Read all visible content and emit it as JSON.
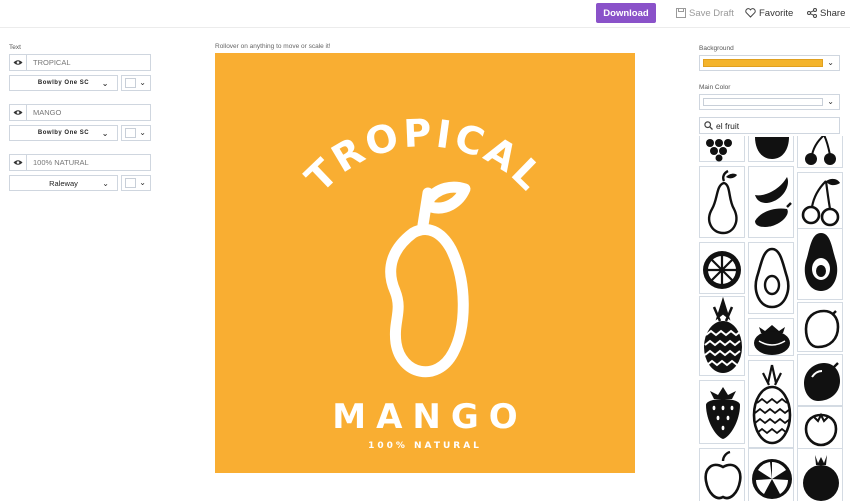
{
  "toolbar": {
    "download_label": "Download",
    "save_draft_label": "Save Draft",
    "favorite_label": "Favorite",
    "share_label": "Share"
  },
  "left_panel": {
    "section_label": "Text",
    "layers": [
      {
        "text": "TROPICAL",
        "font": "Bowlby One SC",
        "color": "#ffffff"
      },
      {
        "text": "MANGO",
        "font": "Bowlby One SC",
        "color": "#ffffff"
      },
      {
        "text": "100% NATURAL",
        "font": "Raleway",
        "color": "#ffffff"
      }
    ]
  },
  "canvas": {
    "hint": "Rollover on anything to move or scale it!",
    "background": "#f9ae32",
    "line1": "TROPICAL",
    "line2": "MANGO",
    "line3": "100% NATURAL"
  },
  "right_panel": {
    "background_label": "Background",
    "background_color": "#f4b42c",
    "main_color_label": "Main Color",
    "main_color": "#ffffff",
    "search_value": "el fruit",
    "icons": [
      "grapes-icon",
      "apple-icon",
      "cherries-icon",
      "pear-icon",
      "bananas-icon",
      "cherries-outline-icon",
      "citrus-slice-icon",
      "avocado-outline-icon",
      "avocado-icon",
      "pineapple-icon",
      "mangosteen-icon",
      "lemon-outline-icon",
      "strawberry-icon",
      "pineapple-outline-icon",
      "lemon-icon",
      "apple-outline-icon",
      "orange-slice-icon",
      "pomegranate-icon"
    ]
  }
}
